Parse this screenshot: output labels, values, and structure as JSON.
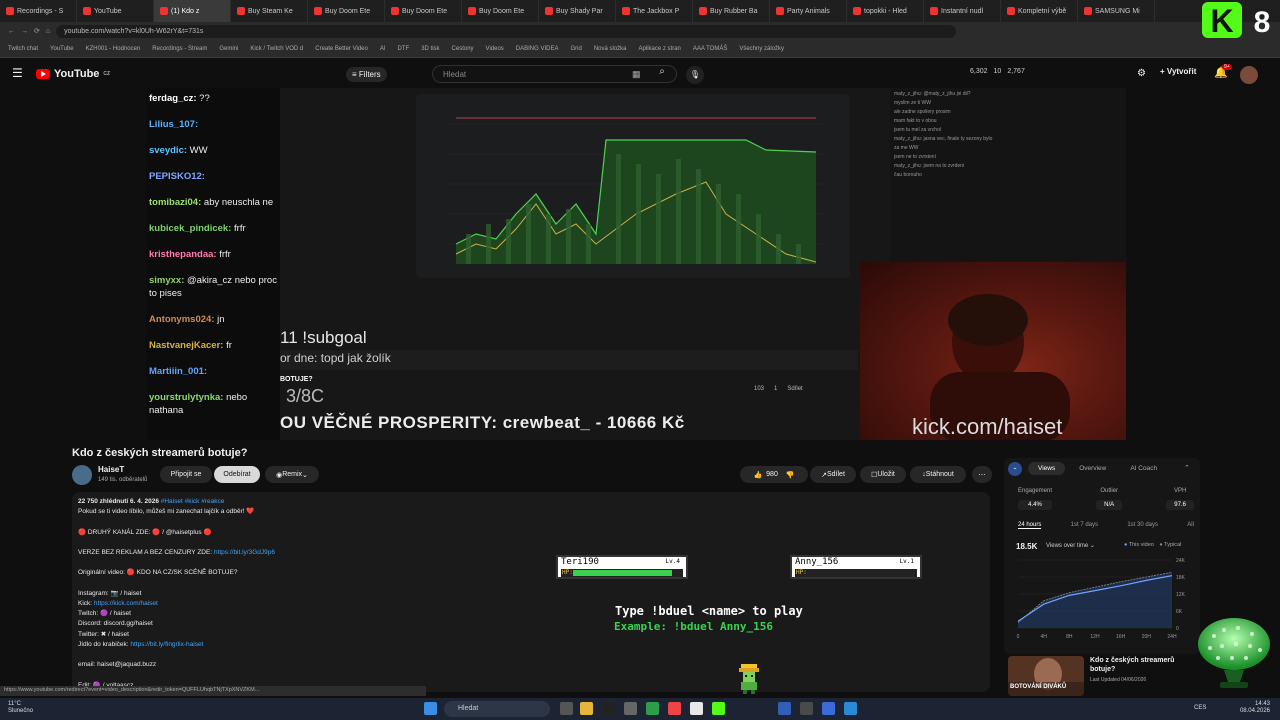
{
  "browser": {
    "tabs": [
      "Recordings - S",
      "YouTube",
      "(1) Kdo z",
      "Buy Steam Ke",
      "Buy Doom Ete",
      "Buy Doom Ete",
      "Buy Doom Ete",
      "Buy Shady Par",
      "The Jackbox P",
      "Buy Rubber Ba",
      "Party Animals",
      "topokki - Hled",
      "Instantní nudl",
      "Kompletní výbě",
      "SAMSUNG Mi"
    ],
    "url": "youtube.com/watch?v=kl0Uh-W62rY&t=731s",
    "bookmarks": [
      "Twitch chat",
      "YouTube",
      "KZH001 - Hodnocen",
      "Recordings - Stream",
      "Gemini",
      "Kick / Twitch VOD d",
      "Create Better Video",
      "AI",
      "DTF",
      "3D tisk",
      "Cestony",
      "Videos",
      "DABING VIDEA",
      "Grid",
      "Nová složka",
      "Aplikace z stran",
      "AAA TOMÁŠ",
      "Všechny záložky"
    ]
  },
  "header": {
    "logo": "YouTube",
    "logo_country": "CZ",
    "filters_label": "Filters",
    "search_placeholder": "Hledat",
    "stats": [
      "6,302",
      "10",
      "2,767"
    ],
    "create_label": "Vytvořit",
    "notif_count": "9+"
  },
  "video": {
    "chat": [
      {
        "user": "ferdag_cz:",
        "msg": "??",
        "color": "#ffffff"
      },
      {
        "user": "Lilius_107:",
        "msg": "",
        "color": "#56b4ff"
      },
      {
        "user": "sveydic:",
        "msg": "WW",
        "color": "#5ec4ff"
      },
      {
        "user": "PEPISKO12:",
        "msg": "",
        "color": "#7da7ff"
      },
      {
        "user": "tomibazi04:",
        "msg": "aby neuschla ne",
        "color": "#9be06c"
      },
      {
        "user": "kubicek_pindicek:",
        "msg": "frfr",
        "color": "#7fd36a"
      },
      {
        "user": "kristhepandaa:",
        "msg": "frfr",
        "color": "#ff7bb0"
      },
      {
        "user": "simyxx:",
        "msg": "@akira_cz nebo proc to pises",
        "color": "#8fd16b"
      },
      {
        "user": "Antonyms024:",
        "msg": "jn",
        "color": "#d08a55"
      },
      {
        "user": "NastvanejKacer:",
        "msg": "fr",
        "color": "#d6b244"
      },
      {
        "user": "Martiiin_001:",
        "msg": "",
        "color": "#5da7ff"
      },
      {
        "user": "yourstrulytynka:",
        "msg": "nebo nathana",
        "color": "#8bd96f"
      }
    ],
    "subgoal": "11 !subgoal",
    "rec_dne": "or dne: topd jak žolík",
    "botuje": "BOTUJE?",
    "pct_text": "3/8C",
    "prosperity": "OU VĚČNÉ PROSPERITY: crewbeat_ - 10666 Kč",
    "kick_url": "kick.com/haiset",
    "graph_actions": [
      "103",
      "1",
      "Sdílet"
    ],
    "right_chat": [
      "maty_z_jihu: @maty_z_jihu jsi dil?",
      "myslim ze ti WW",
      "ale zadne spoilery prosim",
      "mam fakt to v obou",
      "jsem tu mel za vrchol",
      "maty_z_jihu: jasna vec, finale ty sezony bylo",
      "za me WW",
      "jsem ne to zvrstení",
      "maty_z_jihu: jsem na to zvrdeni",
      "čau borouho"
    ]
  },
  "title": "Kdo z českých streamerů botuje?",
  "channel": {
    "name": "HaiseT",
    "subs": "149 tis. odběratelů",
    "join_label": "Připojit se",
    "subscribe_label": "Odebírat",
    "remix_label": "Remix"
  },
  "actions": {
    "likes": "980",
    "share": "Sdílet",
    "save": "Uložit",
    "download": "Stáhnout"
  },
  "description": {
    "meta": "22 750 zhlédnutí  6. 4. 2026",
    "tags": "#Haiset #kick #reakce",
    "line1": "Pokud se ti video líbilo, můžeš mi zanechat lajčík a odběr! ❤️",
    "line2": "🔴 DRUHÝ KANÁL ZDE: 🔴 / @haisetplus 🔴",
    "line3_text": "VERZE BEZ REKLAM A BEZ CENZURY ZDE: ",
    "line3_link": "https://bit.ly/3GdJ9p6",
    "line4": "Originální video: 🔴 KDO NA CZ/SK SCÉNĚ BOTUJE?",
    "instagram": "Instagram: 📷 / haiset",
    "kick_text": "Kick: ",
    "kick_link": "https://kick.com/haiset",
    "twitch": "Twitch: 🟣 / haiset",
    "discord": "Discord: discord.gg/haiset",
    "twitter": "Twitter: ✖ / haiset",
    "jidlo_text": "Jídlo do krabiček: ",
    "jidlo_link": "https://bit.ly/fingrlix-haiset",
    "email": "email: haiset@jaquad.buzz",
    "edit": "Edit: 🟣 / voltaascz",
    "status_url": "https://www.youtube.com/redirect?event=video_description&redir_token=QUFFLUhqbTNjTXpXNVZKM..."
  },
  "game": {
    "player1": {
      "name": "Teri190",
      "level": "Lv.4",
      "hp": 0.9
    },
    "player2": {
      "name": "Anny_156",
      "level": "Lv.1",
      "hp": 0.0
    },
    "hp_label": "HP:",
    "type_cmd": "Type !bduel <name> to play",
    "example": "Example: !bduel Anny_156"
  },
  "analytics": {
    "tabs": [
      "Views",
      "Overview",
      "AI Coach"
    ],
    "metrics": [
      {
        "label": "Engagement",
        "value": "4.4%"
      },
      {
        "label": "Outlier",
        "value": "N/A"
      },
      {
        "label": "VPH",
        "value": "97.6"
      }
    ],
    "ranges": [
      "24 hours",
      "1st 7 days",
      "1st 30 days",
      "All"
    ],
    "views_total": "18.5K",
    "views_selector": "Views over time",
    "legend": [
      "This video",
      "Typical"
    ],
    "x_labels": [
      "0",
      "4H",
      "8H",
      "12H",
      "16H",
      "20H",
      "24H"
    ],
    "y_labels": [
      "24K",
      "18K",
      "12K",
      "6K",
      "0"
    ],
    "this_video_curve": [
      0.1,
      0.35,
      0.48,
      0.55,
      0.62,
      0.7,
      0.77
    ],
    "typical_curve": [
      0.08,
      0.4,
      0.52,
      0.6,
      0.68,
      0.75,
      0.82
    ]
  },
  "related": {
    "title": "Kdo z českých streamerů botuje?",
    "sub": "Last Updated 04/06/2026",
    "thumb_text": "BOTOVÁNÍ DIVÁKŮ"
  },
  "overlay": {
    "k_letter": "K",
    "k_number": "8"
  },
  "taskbar": {
    "temp": "11°C",
    "weather": "Slunečno",
    "search": "Hledat",
    "lang": "CES",
    "time": "14:43",
    "date": "08.04.2026"
  }
}
